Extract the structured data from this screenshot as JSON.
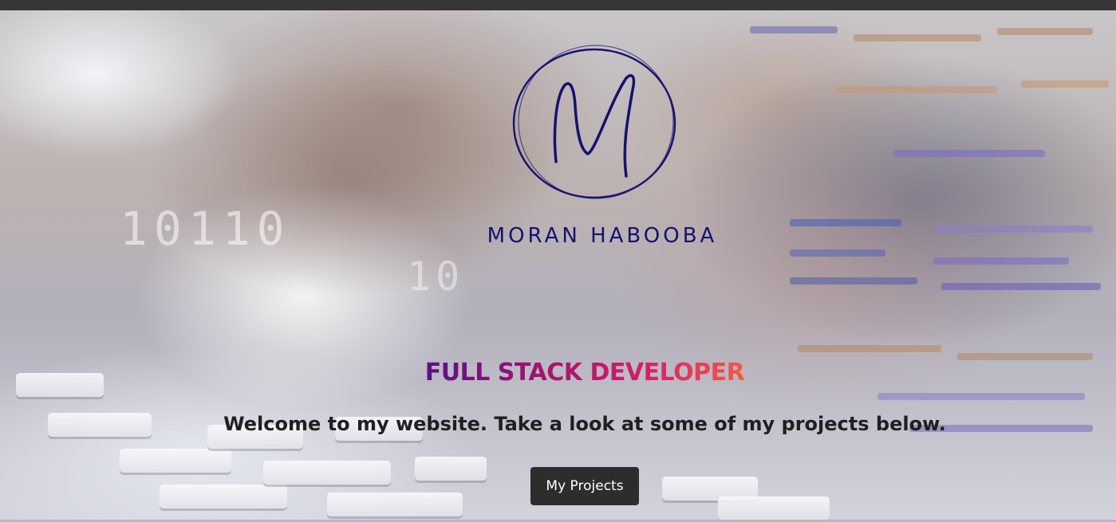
{
  "brand": {
    "logo_letter": "M",
    "name": "MORAN HABOOBA"
  },
  "hero": {
    "decorative_binary_1": "10110",
    "decorative_binary_2": "10",
    "headline": "FULL STACK DEVELOPER",
    "welcome_text": "Welcome to my website. Take a look at some of my projects below.",
    "cta_label": "My Projects"
  },
  "colors": {
    "top_bar": "#363636",
    "brand_navy": "#15126e",
    "headline_gradient_start": "#5b0f86",
    "headline_gradient_end": "#f35a45",
    "button_bg": "#2d2d2d",
    "button_text": "#ffffff"
  }
}
